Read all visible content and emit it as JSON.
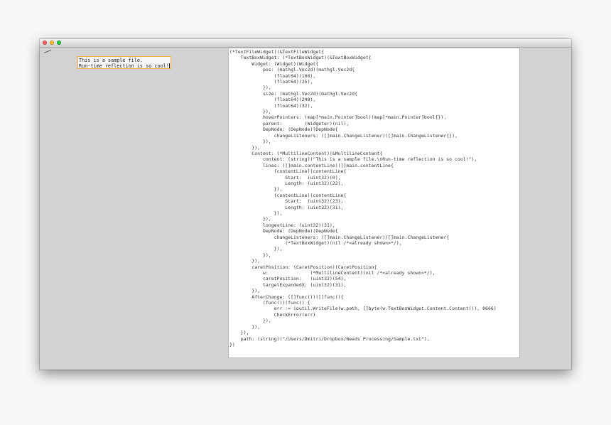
{
  "window": {
    "traffic_lights": {
      "close_color": "#ff5f57",
      "minimize_color": "#ffbd2e",
      "maximize_color": "#28c940"
    }
  },
  "editor": {
    "text": "This is a sample file.\nRun-time reflection is so cool!",
    "focus_border_color": "#f0b347"
  },
  "code_view": {
    "lines": [
      "(*TextFileWidget)(&TextFileWidget{",
      "    TextBoxWidget: (*TextBoxWidget)(&TextBoxWidget{",
      "        Widget: (Widget)(Widget{",
      "            pos: (mathgl.Vec2d)(mathgl.Vec2d{",
      "                (float64)(100),",
      "                (float64)(25),",
      "            }),",
      "            size: (mathgl.Vec2d)(mathgl.Vec2d{",
      "                (float64)(248),",
      "                (float64)(32),",
      "            }),",
      "            hoverPointers: (map[*main.Pointer]bool)(map[*main.Pointer]bool{}),",
      "            parent:        (Widgeter)(nil),",
      "            DepNode: (DepNode)(DepNode{",
      "                changeListeners: ([]main.ChangeListener)([]main.ChangeListener{}),",
      "            }),",
      "        }),",
      "        Content: (*MultilineContent)(&MultilineContent{",
      "            content: (string)(\"This is a sample file.\\nRun-time reflection is so cool!\"),",
      "            lines: ([]main.contentLine)([]main.contentLine{",
      "                (contentLine)(contentLine{",
      "                    Start:  (uint32)(0),",
      "                    Length: (uint32)(22),",
      "                }),",
      "                (contentLine)(contentLine{",
      "                    Start:  (uint32)(23),",
      "                    Length: (uint32)(31),",
      "                }),",
      "            }),",
      "            longestLine: (uint32)(31),",
      "            DepNode: (DepNode)(DepNode{",
      "                changeListeners: ([]main.ChangeListener)([]main.ChangeListener{",
      "                    (*TextBoxWidget)(nil /*<already shown>*/),",
      "                }),",
      "            }),",
      "        }),",
      "        caretPosition: (CaretPosition)(CaretPosition{",
      "            w:               (*MultilineContent)(nil /*<already shown>*/),",
      "            caretPosition:   (uint32)(54),",
      "            targetExpandedX: (uint32)(31),",
      "        }),",
      "        AfterChange: ([]func())([]func(){",
      "            (func())(func() {",
      "                err := ioutil.WriteFile(w.path, []byte(w.TextBoxWidget.Content.Content()), 0666)",
      "                CheckError(err)",
      "            }),",
      "        }),",
      "    }),",
      "    path: (string)(\"/Users/Dmitri/Dropbox/Needs Processing/Sample.txt\"),",
      "})"
    ]
  }
}
